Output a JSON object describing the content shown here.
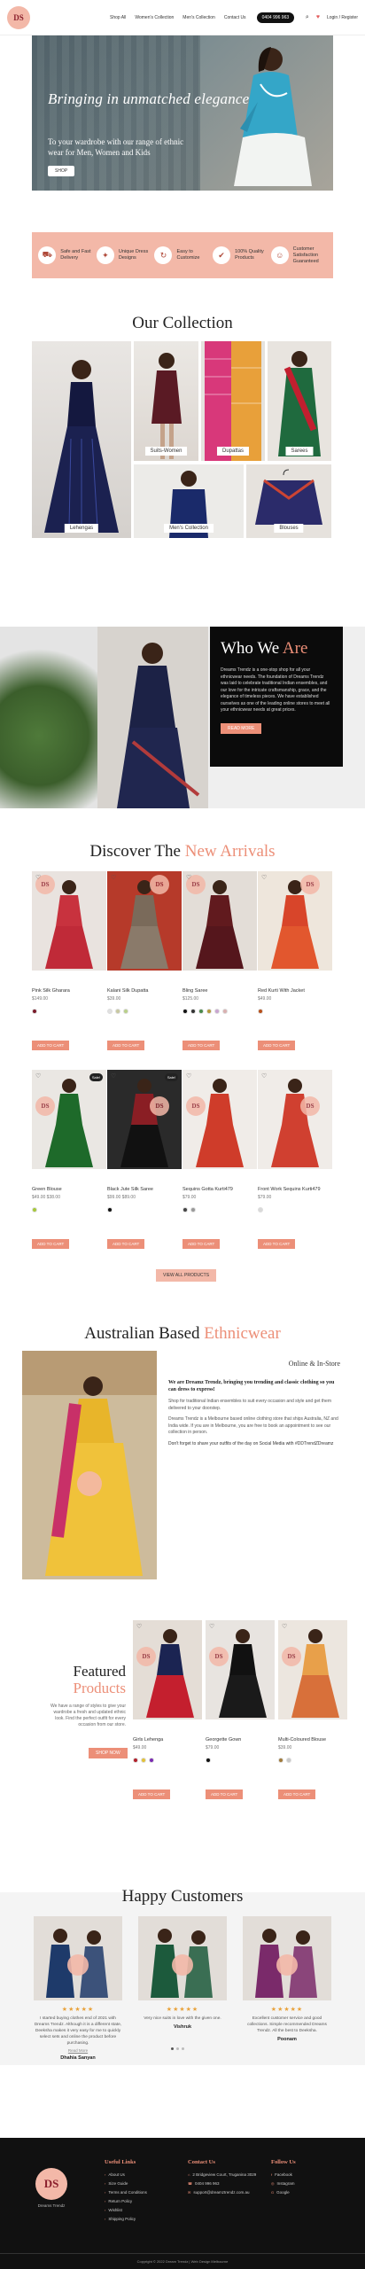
{
  "header": {
    "logo": "DS",
    "nav": [
      "Shop All",
      "Women's Collection",
      "Men's Collection",
      "Contact Us"
    ],
    "phone": "0404 996 963",
    "login": "Login / Register"
  },
  "hero": {
    "title": "Bringing in unmatched elegance",
    "subtitle": "To your wardrobe with our range of ethnic wear for Men, Women and Kids",
    "button": "SHOP"
  },
  "features": [
    {
      "icon": "truck-icon",
      "label": "Safe and Fast Delivery"
    },
    {
      "icon": "star-icon",
      "label": "Unique Dress Designs"
    },
    {
      "icon": "return-icon",
      "label": "Easy to Customize"
    },
    {
      "icon": "quality-icon",
      "label": "100% Quality Products"
    },
    {
      "icon": "smile-icon",
      "label": "Customer Satisfaction Guaranteed"
    }
  ],
  "collection": {
    "title": "Our Collection",
    "tiles": [
      "Lehengas",
      "Suits-Women",
      "Dupattas",
      "Sarees",
      "Men's Collection",
      "Blouses"
    ]
  },
  "who": {
    "title_main": "Who We ",
    "title_accent": "Are",
    "text": "Dreams Trendz is a one-stop shop for all your ethnicwear needs. The foundation of Dreams Trendz was laid to celebrate traditional Indian ensembles, and our love for the intricate craftsmanship, grace, and the elegance of timeless pieces. We have established ourselves as one of the leading online stores to meet all your ethnicwear needs at great prices.",
    "button": "READ MORE"
  },
  "arrivals": {
    "title_main": "Discover The ",
    "title_accent": "New Arrivals",
    "view_all": "VIEW ALL PRODUCTS",
    "products": [
      {
        "name": "Pink Silk Gharara",
        "price": "$149.00",
        "swatches": [
          "#7a1a2a"
        ]
      },
      {
        "name": "Kalani Silk Dupatta",
        "price": "$39.00",
        "swatches": [
          "#e0e0e0",
          "#c8c8a0",
          "#b9d08a"
        ]
      },
      {
        "name": "Bling Saree",
        "price": "$125.00",
        "swatches": [
          "#111111",
          "#333333",
          "#4a8a4a",
          "#b59a3a",
          "#c9a5d0",
          "#d9b0b0"
        ]
      },
      {
        "name": "Red Kurti With Jacket",
        "price": "$49.00",
        "swatches": [
          "#b8501a"
        ]
      },
      {
        "name": "Green Blouse",
        "price": "$49.00 $38.00",
        "swatches": [
          "#a6c83a"
        ]
      },
      {
        "name": "Black Jute Silk Saree",
        "price": "$99.00 $89.00",
        "swatches": [
          "#111111"
        ]
      },
      {
        "name": "Sequins Gotta Kurti479",
        "price": "$79.00",
        "swatches": [
          "#444444",
          "#999999"
        ]
      },
      {
        "name": "Front Work Sequins Kurti479",
        "price": "$79.00",
        "swatches": [
          "#d9d9d9"
        ]
      }
    ]
  },
  "australian": {
    "title_main": "Australian Based ",
    "title_accent": "Ethnicwear",
    "sub": "Online & In-Store",
    "lead": "We are Dreamz Trendz, bringing you trending and classic clothing so you can dress to express!",
    "paras": [
      "Shop for traditional Indian ensembles to suit every occasion and style and get them delivered to your doorstep.",
      "Dreams Trendz is a Melbourne based online clothing store that ships Australia, NZ and India wide. If you are in Melbourne, you are free to book an appointment to see our collection in person.",
      "Don't forget to share your outfits of the day on Social Media with #DDTrendZDreamz"
    ]
  },
  "featured": {
    "title_main": "Featured",
    "title_accent": "Products",
    "desc": "We have a range of styles to give your wardrobe a fresh and updated ethnic look. Find the perfect outfit for every occasion from our store.",
    "button": "SHOP NOW",
    "products": [
      {
        "name": "Girls Lehenga",
        "price": "$49.00",
        "swatches": [
          "#b21f2a",
          "#e2c23a",
          "#7a2ab2"
        ]
      },
      {
        "name": "Georgette Gown",
        "price": "$79.00",
        "swatches": [
          "#111111"
        ]
      },
      {
        "name": "Multi-Coloured Blouse",
        "price": "$39.00",
        "swatches": [
          "#a07a3a",
          "#c9c9c9"
        ]
      }
    ]
  },
  "testimonials": {
    "title": "Happy Customers",
    "items": [
      {
        "stars": "★★★★★",
        "quote": "I started buying clothes end of 2021 with Dreams Trendz. Although it is a different state, Deeksha makes it very easy for me to quickly select sets and online the product before purchasing.",
        "read_more": "Read More",
        "name": "Dhahia Sanyan"
      },
      {
        "stars": "★★★★★",
        "quote": "Very nice suits in love with the given one.",
        "read_more": "",
        "name": "Vishruk"
      },
      {
        "stars": "★★★★★",
        "quote": "Excellent customer service and good collections. Simple recommended Dreams Trendz. All the best to Deeksha.",
        "read_more": "",
        "name": "Poonam"
      }
    ]
  },
  "footer": {
    "logo": "DS",
    "logo_caption": "Dreams Trendz",
    "useful_title": "Useful Links",
    "useful": [
      "About Us",
      "Size Guide",
      "Terms and Conditions",
      "Return Policy",
      "Wishlist",
      "Shipping Policy"
    ],
    "contact_title": "Contact Us",
    "contact": [
      "2 Bridgeview Court, Truganina 3029",
      "0404 996 963",
      "support@dreamztrendz.com.au"
    ],
    "follow_title": "Follow Us",
    "follow": [
      "Facebook",
      "Instagram",
      "Google"
    ],
    "copyright": "Copyright © 2022 Dream Trendz | Web Design Melbourne"
  }
}
